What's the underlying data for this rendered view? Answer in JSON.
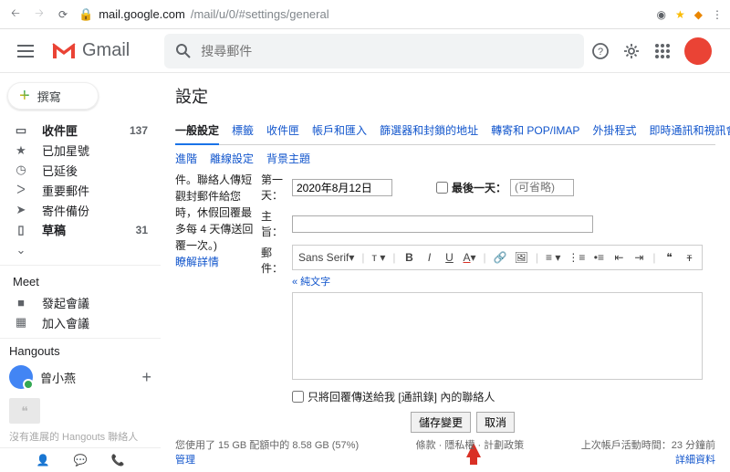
{
  "browser": {
    "url_host": "mail.google.com",
    "url_path": "/mail/u/0/#settings/general"
  },
  "header": {
    "brand": "Gmail",
    "search_placeholder": "搜尋郵件"
  },
  "sidebar": {
    "compose": "撰寫",
    "items": [
      {
        "icon": "inbox",
        "label": "收件匣",
        "count": "137",
        "bold": true
      },
      {
        "icon": "star",
        "label": "已加星號"
      },
      {
        "icon": "clock",
        "label": "已延後"
      },
      {
        "icon": "chev",
        "label": "重要郵件"
      },
      {
        "icon": "send",
        "label": "寄件備份"
      },
      {
        "icon": "draft",
        "label": "草稿",
        "count": "31",
        "bold": true
      },
      {
        "icon": "caret",
        "label": ""
      }
    ],
    "meet_header": "Meet",
    "meet": [
      {
        "icon": "video",
        "label": "發起會議"
      },
      {
        "icon": "grid",
        "label": "加入會議"
      }
    ],
    "hangouts_header": "Hangouts",
    "hangouts_user": "曾小燕",
    "hangouts_empty": "沒有進展的 Hangouts 聯絡人"
  },
  "settings": {
    "page_title": "設定",
    "tabs": [
      "一般設定",
      "標籤",
      "收件匣",
      "帳戶和匯入",
      "篩選器和封鎖的地址",
      "轉寄和 POP/IMAP",
      "外掛程式",
      "即時通訊和視訊會議"
    ],
    "subtabs": [
      "進階",
      "離線設定",
      "背景主題"
    ],
    "left_note": "件。聯絡人傳短觀封郵件給您時，休假回覆最多每 4 天傳送回覆一次。)",
    "learn_more": "瞭解詳情",
    "first_day_label": "第一天：",
    "date_value": "2020年8月12日",
    "last_day_label": "最後一天：",
    "last_day_ph": "(可省略)",
    "subject_label": "主旨：",
    "body_label": "郵件：",
    "font_family": "Sans Serif",
    "plain_text": "« 純文字",
    "only_contacts": "只將回覆傳送給我 [通訊錄] 內的聯絡人",
    "save": "儲存變更",
    "cancel": "取消"
  },
  "footer": {
    "storage": "您使用了 15 GB 配額中的 8.58 GB (57%)",
    "manage": "管理",
    "policies": "條款 · 隱私權 · 計劃政策",
    "activity": "上次帳戶活動時間：23 分鐘前",
    "details": "詳細資料"
  }
}
